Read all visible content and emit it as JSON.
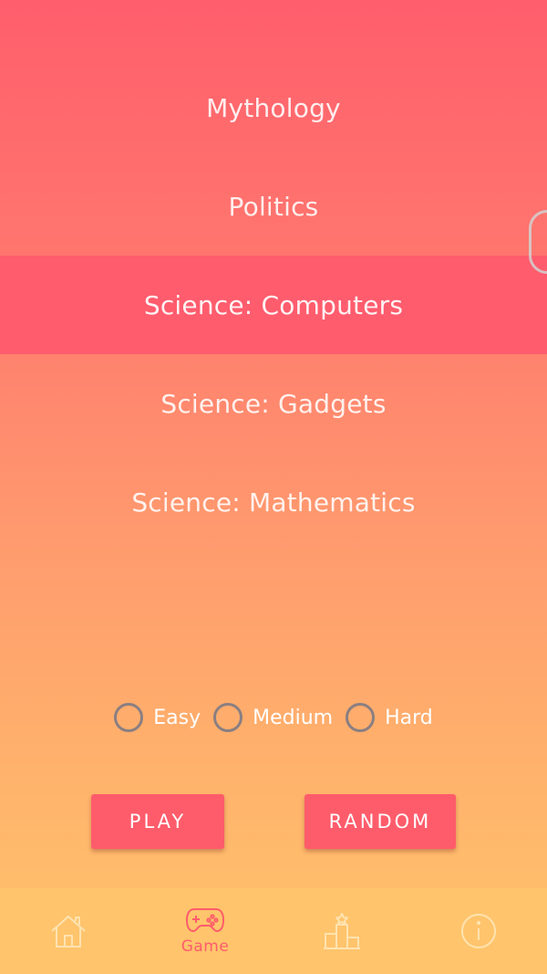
{
  "categories": {
    "items": [
      {
        "label": "Mythology"
      },
      {
        "label": "Politics"
      },
      {
        "label": "Science: Computers"
      },
      {
        "label": "Science: Gadgets"
      },
      {
        "label": "Science: Mathematics"
      }
    ],
    "selected_label": "Science: Computers"
  },
  "difficulty": {
    "options": [
      {
        "label": "Easy"
      },
      {
        "label": "Medium"
      },
      {
        "label": "Hard"
      }
    ]
  },
  "actions": {
    "play_label": "PLAY",
    "random_label": "RANDOM"
  },
  "bottom_nav": {
    "items": [
      {
        "icon": "home-icon",
        "label": ""
      },
      {
        "icon": "gamepad-icon",
        "label": "Game",
        "active": true
      },
      {
        "icon": "leaderboard-icon",
        "label": ""
      },
      {
        "icon": "info-icon",
        "label": ""
      }
    ]
  },
  "colors": {
    "accent": "#ff5c6b",
    "gradient_top": "#ff5e6c",
    "gradient_bottom": "#ffc56a",
    "nav_background": "#ffc46c",
    "inactive_icon": "#ffe3b0"
  }
}
